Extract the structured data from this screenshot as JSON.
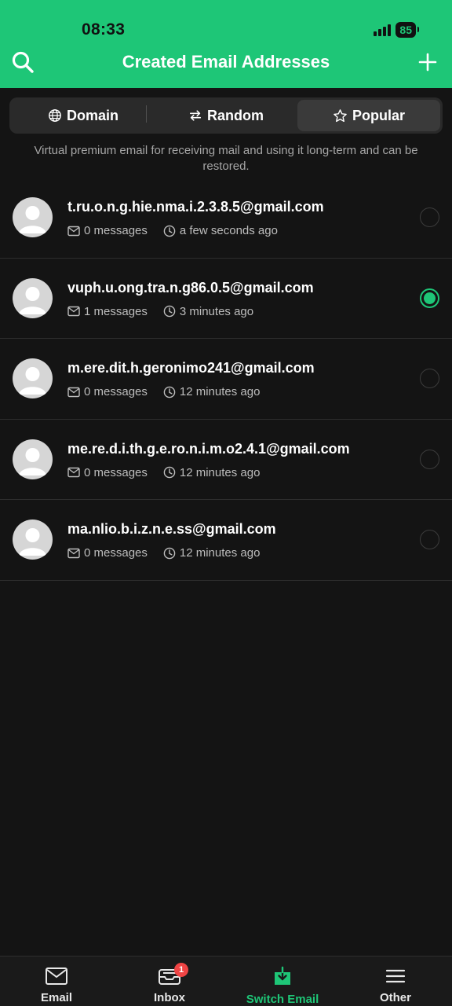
{
  "status_bar": {
    "time": "08:33",
    "battery": "85"
  },
  "header": {
    "title": "Created Email Addresses"
  },
  "tabs": [
    {
      "label": "Domain",
      "icon": "globe-icon",
      "active": false
    },
    {
      "label": "Random",
      "icon": "shuffle-icon",
      "active": false
    },
    {
      "label": "Popular",
      "icon": "star-icon",
      "active": true
    }
  ],
  "subtitle": "Virtual premium email for receiving mail and using it long-term and can be restored.",
  "emails": [
    {
      "address": "t.ru.o.n.g.hie.nma.i.2.3.8.5@gmail.com",
      "messages": "0 messages",
      "time": "a few seconds ago",
      "selected": false
    },
    {
      "address": "vuph.u.ong.tra.n.g86.0.5@gmail.com",
      "messages": "1 messages",
      "time": "3 minutes ago",
      "selected": true
    },
    {
      "address": "m.ere.dit.h.geronimo241@gmail.com",
      "messages": "0 messages",
      "time": "12 minutes ago",
      "selected": false
    },
    {
      "address": "me.re.d.i.th.g.e.ro.n.i.m.o2.4.1@gmail.com",
      "messages": "0 messages",
      "time": "12 minutes ago",
      "selected": false
    },
    {
      "address": "ma.nlio.b.i.z.n.e.ss@gmail.com",
      "messages": "0 messages",
      "time": "12 minutes ago",
      "selected": false
    }
  ],
  "bottom_nav": [
    {
      "label": "Email",
      "icon": "mail-icon",
      "active": false
    },
    {
      "label": "Inbox",
      "icon": "inbox-icon",
      "active": false,
      "badge": "1"
    },
    {
      "label": "Switch Email",
      "icon": "switch-email-icon",
      "active": true
    },
    {
      "label": "Other",
      "icon": "menu-icon",
      "active": false
    }
  ],
  "colors": {
    "accent": "#1ec677",
    "background": "#141414",
    "badge": "#ef4444"
  }
}
